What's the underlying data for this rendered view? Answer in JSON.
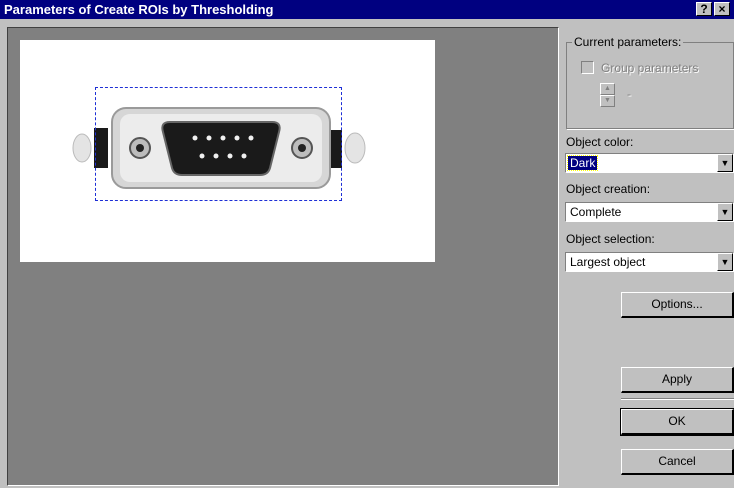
{
  "window": {
    "title": "Parameters of Create ROIs by Thresholding",
    "help_label": "?",
    "close_label": "×"
  },
  "params": {
    "current_label": "Current parameters:",
    "group_label": "Group parameters",
    "group_checked": false,
    "spin_value": "-",
    "object_color": {
      "label": "Object color:",
      "value": "Dark"
    },
    "object_creation": {
      "label": "Object creation:",
      "value": "Complete"
    },
    "object_selection": {
      "label": "Object selection:",
      "value": "Largest object"
    }
  },
  "buttons": {
    "options": "Options...",
    "apply": "Apply",
    "ok": "OK",
    "cancel": "Cancel"
  },
  "colors": {
    "titlebar": "#000080",
    "roi_outline": "#1e2fd6"
  }
}
